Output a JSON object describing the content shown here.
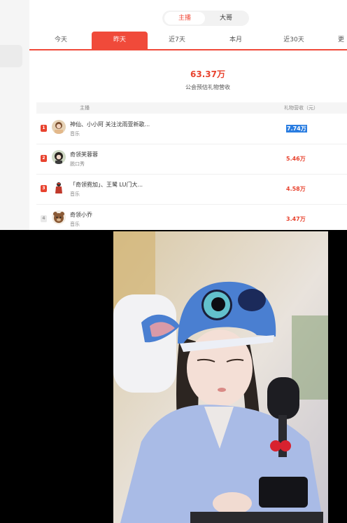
{
  "segment": {
    "items": [
      "主播",
      "大哥"
    ],
    "active": "主播"
  },
  "tabs": [
    "今天",
    "昨天",
    "近7天",
    "本月",
    "近30天",
    "更"
  ],
  "active_tab": "昨天",
  "summary": {
    "total": "63.37万",
    "label": "公会预估礼物营收"
  },
  "table": {
    "headers": {
      "streamer": "主播",
      "revenue": "礼物营收（元）"
    },
    "rows": [
      {
        "rank": "1",
        "name": "神仙、小小阿 关注沈雨萱新歌...",
        "category": "音乐",
        "value": "7.74万"
      },
      {
        "rank": "2",
        "name": "奇领芙蓉蓉",
        "category": "脱口秀",
        "value": "5.46万"
      },
      {
        "rank": "3",
        "name": "「奇领霓加」、王鹭 LU门大...",
        "category": "音乐",
        "value": "4.58万"
      },
      {
        "rank": "4",
        "name": "奇领小乔",
        "category": "音乐",
        "value": "3.47万"
      }
    ]
  },
  "colors": {
    "accent": "#f04a3a",
    "value": "#e8432f",
    "selection": "#2a7de1"
  }
}
